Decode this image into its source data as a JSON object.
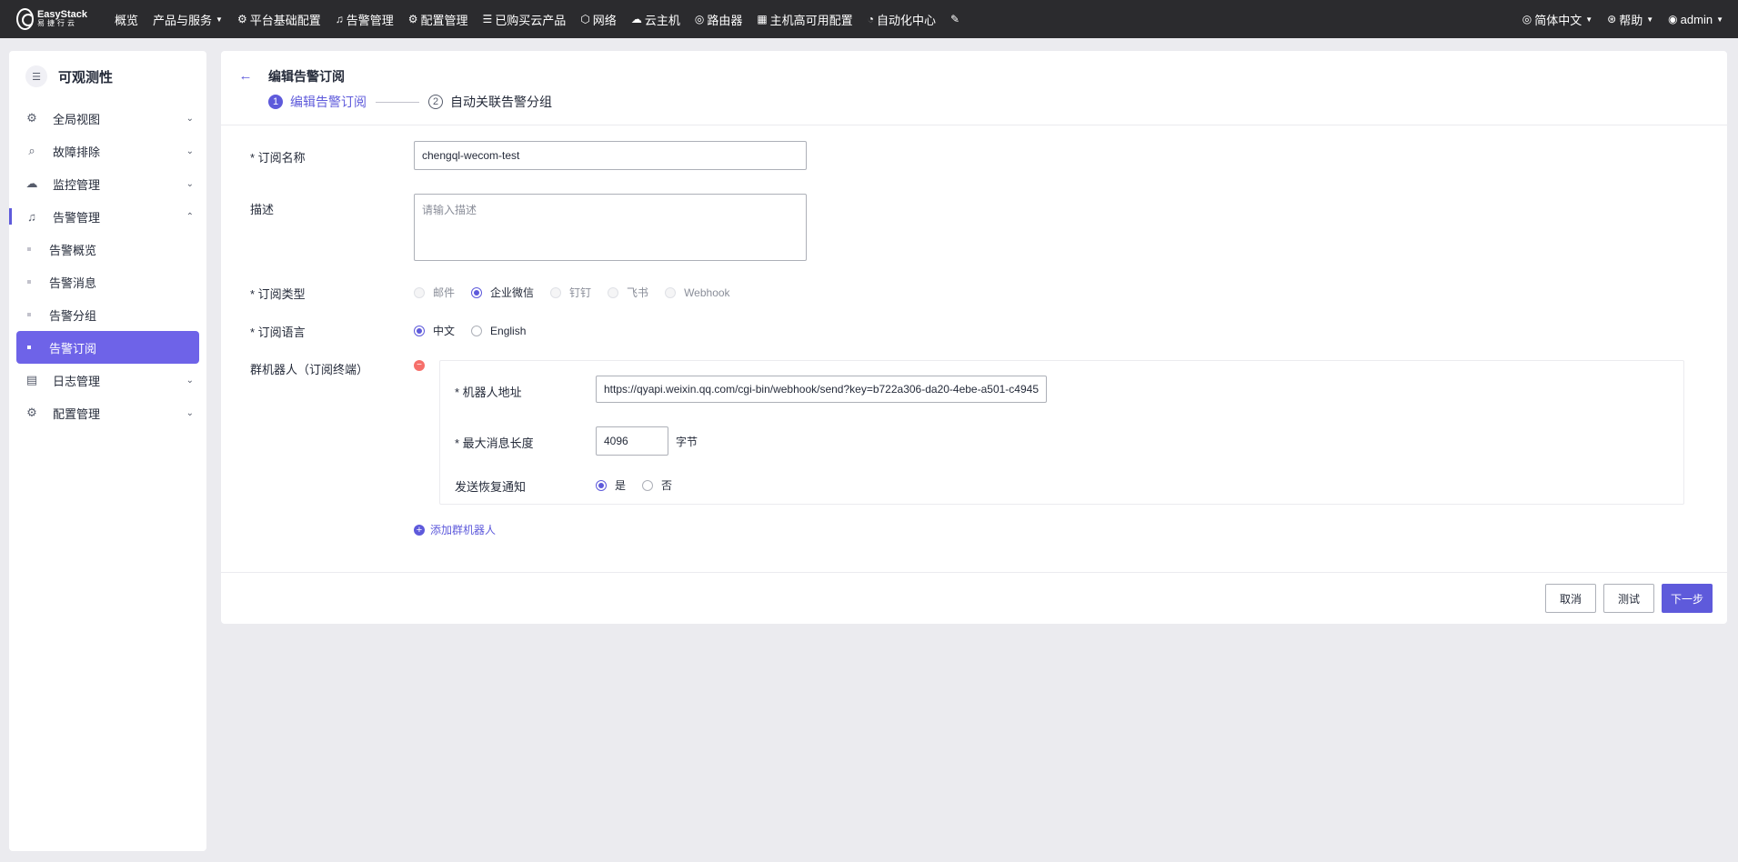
{
  "topbar": {
    "logo_en": "EasyStack",
    "logo_cn": "易捷行云",
    "nav": [
      {
        "label": "概览",
        "icon": "",
        "caret": false
      },
      {
        "label": "产品与服务",
        "icon": "",
        "caret": true
      },
      {
        "label": "平台基础配置",
        "icon": "⚙",
        "caret": false
      },
      {
        "label": "告警管理",
        "icon": "♫",
        "caret": false
      },
      {
        "label": "配置管理",
        "icon": "⚙",
        "caret": false
      },
      {
        "label": "已购买云产品",
        "icon": "☰",
        "caret": false
      },
      {
        "label": "网络",
        "icon": "⬡",
        "caret": false
      },
      {
        "label": "云主机",
        "icon": "☁",
        "caret": false
      },
      {
        "label": "路由器",
        "icon": "◎",
        "caret": false
      },
      {
        "label": "主机高可用配置",
        "icon": "▦",
        "caret": false
      },
      {
        "label": "自动化中心",
        "icon": "◔",
        "caret": false
      },
      {
        "label": "",
        "icon": "✎",
        "caret": false
      }
    ],
    "language": "简体中文",
    "help": "帮助",
    "user": "admin"
  },
  "sidebar": {
    "title": "可观测性",
    "items": [
      {
        "label": "全局视图",
        "icon": "⚙"
      },
      {
        "label": "故障排除",
        "icon": "⌕"
      },
      {
        "label": "监控管理",
        "icon": "☁"
      },
      {
        "label": "告警管理",
        "icon": "♫"
      }
    ],
    "sub_items": [
      "告警概览",
      "告警消息",
      "告警分组",
      "告警订阅"
    ],
    "items_after": [
      {
        "label": "日志管理",
        "icon": "▤"
      },
      {
        "label": "配置管理",
        "icon": "⚙"
      }
    ]
  },
  "page": {
    "title": "编辑告警订阅",
    "steps": [
      {
        "num": "1",
        "label": "编辑告警订阅"
      },
      {
        "num": "2",
        "label": "自动关联告警分组"
      }
    ]
  },
  "form": {
    "name_label": "* 订阅名称",
    "name_value": "chengql-wecom-test",
    "desc_label": "描述",
    "desc_placeholder": "请输入描述",
    "type_label": "* 订阅类型",
    "type_options": [
      "邮件",
      "企业微信",
      "钉钉",
      "飞书",
      "Webhook"
    ],
    "type_selected": "企业微信",
    "lang_label": "* 订阅语言",
    "lang_options": [
      "中文",
      "English"
    ],
    "lang_selected": "中文",
    "robot_label": "群机器人（订阅终端）",
    "robot_addr_label": "* 机器人地址",
    "robot_addr_value": "https://qyapi.weixin.qq.com/cgi-bin/webhook/send?key=b722a306-da20-4ebe-a501-c4945",
    "max_len_label": "* 最大消息长度",
    "max_len_value": "4096",
    "max_len_unit": "字节",
    "recovery_label": "发送恢复通知",
    "recovery_options": [
      "是",
      "否"
    ],
    "recovery_selected": "是",
    "add_robot": "添加群机器人"
  },
  "footer": {
    "cancel": "取消",
    "test": "测试",
    "next": "下一步"
  },
  "colors": {
    "accent": "#5e5adb",
    "topbar": "#2b2b2e",
    "danger": "#f66f6a"
  }
}
